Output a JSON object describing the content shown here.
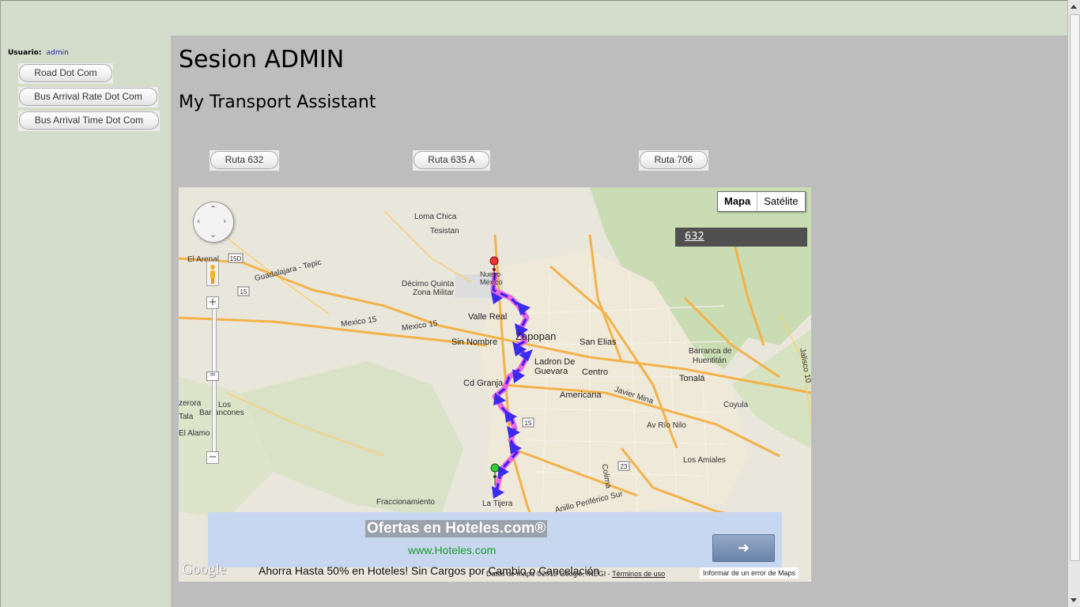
{
  "sidebar": {
    "user_label": "Usuario:",
    "user_name": "admin",
    "buttons": [
      "Road Dot Com",
      "Bus Arrival Rate Dot Com",
      "Bus Arrival Time Dot Com"
    ]
  },
  "main": {
    "title": "Sesion ADMIN",
    "subtitle": "My Transport Assistant",
    "routes": [
      "Ruta 632",
      "Ruta 635 A",
      "Ruta 706"
    ]
  },
  "map": {
    "map_type": [
      "Mapa",
      "Satélite"
    ],
    "route_label": "632",
    "labels": {
      "loma_chica": "Loma Chica",
      "tesistan": "Tesistan",
      "el_arenal": "El Arenal",
      "decimo": "Décimo Quinta",
      "zona_militar": "Zona Militar",
      "nuevo_mexico": "Nuevo",
      "nuevo_mexico2": "México",
      "valle_real": "Valle Real",
      "sin_nombre": "Sin Nombre",
      "zapopan": "Zapopan",
      "san_elias": "San Elias",
      "ladron1": "Ladron De",
      "ladron2": "Guevara",
      "centro": "Centro",
      "cd_granja": "Cd Granja",
      "americana": "Americana",
      "javier_mina": "Javier Mina",
      "tonala": "Tonalá",
      "barranca1": "Barranca de",
      "barranca2": "Huentitán",
      "coyula": "Coyula",
      "rio_nilo": "Av Río Nilo",
      "los_amiales": "Los Amiales",
      "los": "Los",
      "barrancones": "Barrancones",
      "el_alamo": "El Alamo",
      "tala": "Tala",
      "zerora": "zerora",
      "mexico15a": "Mexico 15",
      "mexico15b": "Mexico 15",
      "guadalajara_tepic": "Guadalajara - Tepic",
      "fraccionamiento": "Fraccionamiento",
      "la_tijera": "La Tijera",
      "colima": "Colima",
      "anillo": "Anillo Periférico Sur",
      "jalisco": "Jalisco 10"
    },
    "ad": {
      "title": "Ofertas en Hoteles.com®",
      "url": "www.Hoteles.com",
      "text": "Ahorra Hasta 50% en Hoteles! Sin Cargos por Cambio o Cancelación"
    },
    "google": "Google",
    "footer": {
      "data": "Datos de mapa ©2013 Google, INEGI -",
      "terms": "Términos de uso",
      "report": "Informar de un error de Maps"
    }
  }
}
